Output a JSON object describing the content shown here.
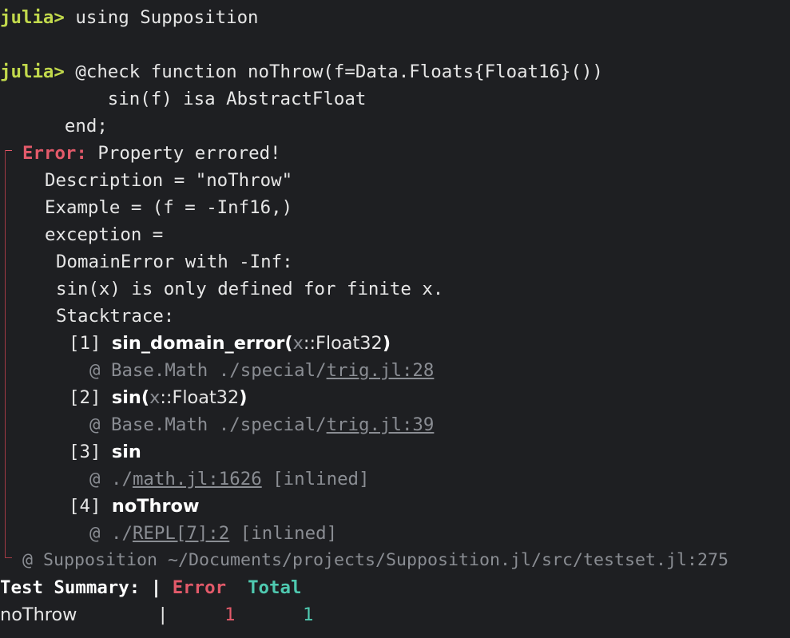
{
  "repl": {
    "prompt": "julia>",
    "cmd1": " using Supposition",
    "cmd2": " @check function noThrow(f=Data.Floats{Float16}())",
    "cmd2_line2": "          sin(f) isa AbstractFloat",
    "cmd2_line3": "      end;"
  },
  "error": {
    "label": "Error:",
    "message": " Property errored!",
    "description": "Description = \"noThrow\"",
    "example": "Example = (f = -Inf16,)",
    "exception": "exception =",
    "domain_error": "DomainError with -Inf:",
    "detail": "sin(x) is only defined for finite x.",
    "stacktrace_label": "Stacktrace:"
  },
  "stack": [
    {
      "index": "[1] ",
      "func": "sin_domain_error",
      "arg": "x",
      "type": "::Float32",
      "at": "@ ",
      "module": "Base.Math ./special/",
      "file": "trig.jl:28",
      "suffix": ""
    },
    {
      "index": "[2] ",
      "func": "sin",
      "arg": "x",
      "type": "::Float32",
      "at": "@ ",
      "module": "Base.Math ./special/",
      "file": "trig.jl:39",
      "suffix": ""
    },
    {
      "index": "[3] ",
      "func": "sin",
      "at": "@ ",
      "module": "./",
      "file": "math.jl:1626",
      "suffix": " [inlined]"
    },
    {
      "index": "[4] ",
      "func": "noThrow",
      "at": "@ ",
      "module": "./",
      "file": "REPL[7]:2",
      "suffix": " [inlined]"
    }
  ],
  "source_location": "@ Supposition ~/Documents/projects/Supposition.jl/src/testset.jl:275",
  "summary": {
    "header_label": "Test Summary:",
    "separator": " | ",
    "col_error": "Error",
    "col_total": "Total",
    "row_name": "noThrow",
    "error_count": "1",
    "total_count": "1"
  },
  "colors": {
    "background": "#1e1f22",
    "prompt": "#c2d94c",
    "error": "#e35a6a",
    "total": "#4fc9b0"
  }
}
